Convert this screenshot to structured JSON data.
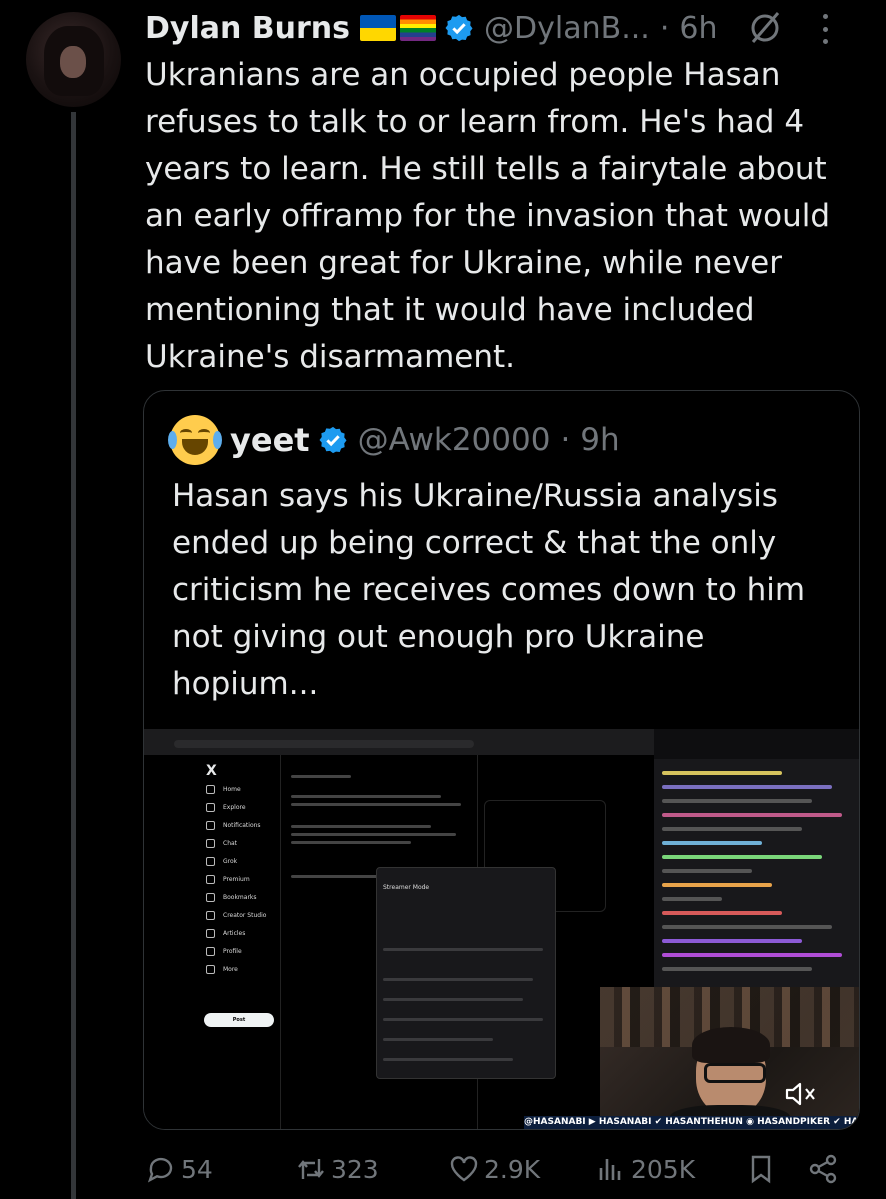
{
  "author": {
    "name": "Dylan Burns",
    "handle": "@DylanB...",
    "sep": "·",
    "time": "6h"
  },
  "tweet_text": "Ukranians are an occupied people Hasan refuses to talk to or learn from. He's had 4 years to learn. He still tells a fairytale about an early offramp for the invasion that would have been great for Ukraine, while never mentioning that it would have included Ukraine's disarmament.",
  "quote": {
    "name": "yeet",
    "handle": "@Awk20000",
    "sep": "·",
    "time": "9h",
    "text": "Hasan says his Ukraine/Russia analysis ended up being correct & that the only criticism he receives comes down to him not giving out enough pro Ukraine hopium...",
    "media": {
      "streamer_mode_label": "Streamer Mode",
      "nav": [
        "Home",
        "Explore",
        "Notifications",
        "Chat",
        "Grok",
        "Premium",
        "Bookmarks",
        "Creator Studio",
        "Articles",
        "Profile",
        "More"
      ],
      "post_button": "Post",
      "ticker": "@HASANABI ▶ HASANABI ✔ HASANTHEHUN ◉ HASANDPIKER ✔ HASANDPIK"
    }
  },
  "actions": {
    "replies": "54",
    "reposts": "323",
    "likes": "2.9K",
    "views": "205K"
  },
  "colors": {
    "accent_verified": "#1d9bf0",
    "muted": "#71767b",
    "text": "#e7e9ea"
  }
}
